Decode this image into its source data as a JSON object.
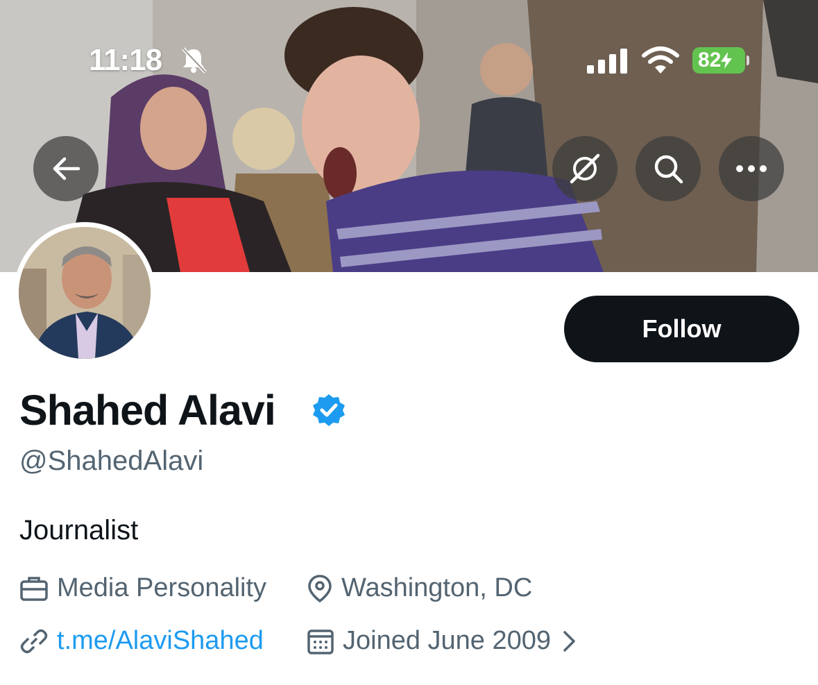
{
  "status_bar": {
    "time": "11:18",
    "battery": "82",
    "icons": [
      "bell-slash-icon",
      "cellular-signal-icon",
      "wifi-icon",
      "battery-charging-icon"
    ]
  },
  "header": {
    "buttons": [
      "back-arrow-icon",
      "grok-icon",
      "search-icon",
      "more-icon"
    ]
  },
  "profile": {
    "follow_label": "Follow",
    "display_name": "Shahed Alavi",
    "handle": "@ShahedAlavi",
    "bio": "Journalist",
    "profession": "Media Personality",
    "location": "Washington, DC",
    "link": "t.me/AlaviShahed",
    "joined": "Joined June 2009"
  },
  "colors": {
    "accent": "#1d9bf0",
    "secondary_text": "#536471",
    "primary_text": "#0f1419",
    "battery_green": "#63c34f"
  }
}
